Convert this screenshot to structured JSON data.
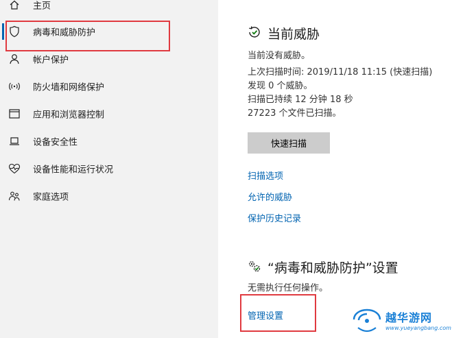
{
  "sidebar": {
    "items": [
      {
        "label": "主页",
        "icon": "home-icon"
      },
      {
        "label": "病毒和威胁防护",
        "icon": "shield-icon",
        "active": true
      },
      {
        "label": "帐户保护",
        "icon": "person-icon"
      },
      {
        "label": "防火墙和网络保护",
        "icon": "wifi-icon"
      },
      {
        "label": "应用和浏览器控制",
        "icon": "app-window-icon"
      },
      {
        "label": "设备安全性",
        "icon": "laptop-icon"
      },
      {
        "label": "设备性能和运行状况",
        "icon": "heart-icon"
      },
      {
        "label": "家庭选项",
        "icon": "family-icon"
      }
    ]
  },
  "threats": {
    "title": "当前威胁",
    "icon": "refresh-shield-icon",
    "lines": [
      "当前没有威胁。",
      "上次扫描时间: 2019/11/18 11:15 (快速扫描)",
      "发现 0 个威胁。",
      "扫描已持续 12 分钟 18 秒",
      "27223 个文件已扫描。"
    ],
    "quick_scan_label": "快速扫描",
    "links": [
      "扫描选项",
      "允许的威胁",
      "保护历史记录"
    ]
  },
  "settings": {
    "title": "“病毒和威胁防护”设置",
    "icon": "gears-icon",
    "description": "无需执行任何操作。",
    "manage_link": "管理设置"
  },
  "watermark": {
    "text": "越华游网",
    "url": "www.yueyangbang.com"
  },
  "colors": {
    "accent": "#0063b1",
    "highlight": "#e0393f",
    "sidebar_bg": "#f2f2f2",
    "button_bg": "#cccccc"
  }
}
